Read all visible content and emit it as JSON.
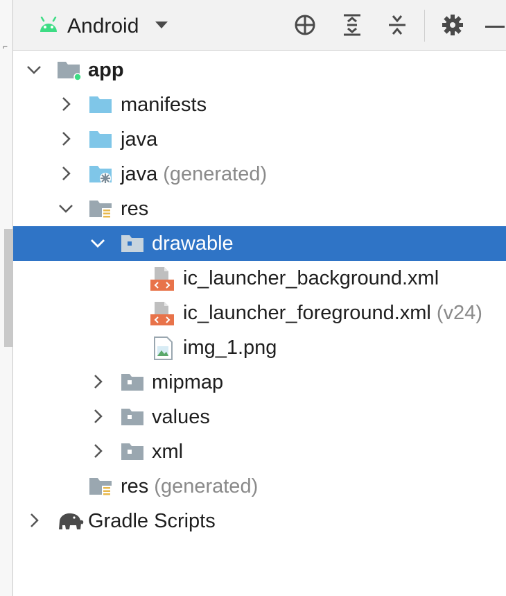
{
  "toolbar": {
    "view_label": "Android",
    "icons": [
      "android-icon",
      "dropdown-arrow-icon",
      "locate-icon",
      "expand-all-icon",
      "collapse-all-icon",
      "gear-icon",
      "minimize-icon"
    ]
  },
  "tree": {
    "app": {
      "label": "app",
      "expanded": true
    },
    "manifests": {
      "label": "manifests",
      "expanded": false
    },
    "java": {
      "label": "java",
      "expanded": false
    },
    "java_generated": {
      "label": "java",
      "suffix": "(generated)",
      "expanded": false
    },
    "res": {
      "label": "res",
      "expanded": true
    },
    "drawable": {
      "label": "drawable",
      "expanded": true,
      "selected": true
    },
    "file_bg": {
      "label": "ic_launcher_background.xml"
    },
    "file_fg": {
      "label": "ic_launcher_foreground.xml",
      "suffix": "(v24)"
    },
    "file_img": {
      "label": "img_1.png"
    },
    "mipmap": {
      "label": "mipmap",
      "expanded": false
    },
    "values": {
      "label": "values",
      "expanded": false
    },
    "xml": {
      "label": "xml",
      "expanded": false
    },
    "res_generated": {
      "label": "res",
      "suffix": "(generated)"
    },
    "gradle": {
      "label": "Gradle Scripts",
      "expanded": false
    }
  },
  "colors": {
    "selection": "#2f74c6",
    "folder_blue": "#7fc6e8",
    "folder_gray": "#9aa7b0",
    "android_green": "#3ddc84",
    "xml_orange": "#e8734a",
    "generated_gray": "#8a8a8a"
  }
}
